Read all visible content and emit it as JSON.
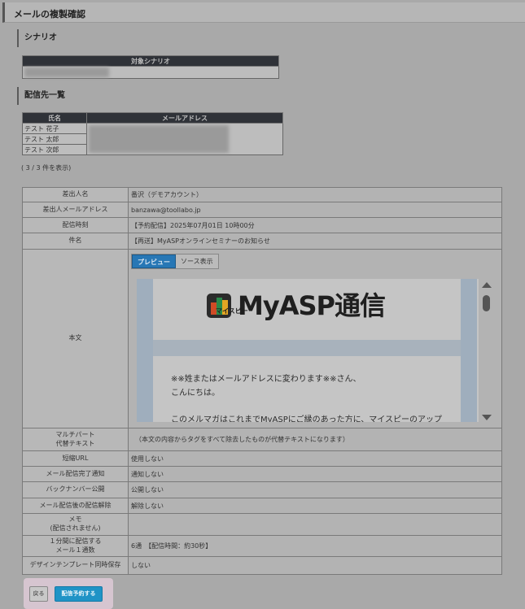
{
  "header": {
    "title": "メールの複製確認"
  },
  "scenario": {
    "section_title": "シナリオ",
    "column": "対象シナリオ"
  },
  "recipients": {
    "section_title": "配信先一覧",
    "columns": {
      "name": "氏名",
      "email": "メールアドレス"
    },
    "rows": [
      {
        "name": "テスト 花子"
      },
      {
        "name": "テスト 太郎"
      },
      {
        "name": "テスト 次郎"
      }
    ],
    "count_text": "( 3 / 3 件を表示)"
  },
  "details": {
    "sender_name": {
      "label": "差出人名",
      "value": "番沢（デモアカウント）"
    },
    "sender_email": {
      "label": "差出人メールアドレス",
      "value": "banzawa@toollabo.jp"
    },
    "send_time": {
      "label": "配信時刻",
      "value": "【予約配信】2025年07月01日 10時00分"
    },
    "subject": {
      "label": "件名",
      "value": "【再送】MyASPオンラインセミナーのお知らせ"
    },
    "body": {
      "label": "本文",
      "tab_preview": "プレビュー",
      "tab_source": "ソース表示",
      "logo_text": "MyASP通信",
      "logo_sub": "マイスピー",
      "line1": "※※姓またはメールアドレスに変わります※※さん、",
      "line2": "こんにちは。",
      "line3": "このメルマガはこれまでMyASPにご縁のあった方に、マイスピーのアップ"
    },
    "multipart": {
      "label_1": "マルチパート",
      "label_2": "代替テキスト",
      "value": "（本文の内容からタグをすべて除去したものが代替テキストになります）"
    },
    "short_url": {
      "label": "短縮URL",
      "value": "使用しない"
    },
    "completion_notice": {
      "label": "メール配信完了通知",
      "value": "通知しない"
    },
    "backnumber": {
      "label": "バックナンバー公開",
      "value": "公開しない"
    },
    "unsubscribe": {
      "label": "メール配信後の配信解除",
      "value": "解除しない"
    },
    "memo": {
      "label_1": "メモ",
      "label_2": "(配信されません)",
      "value": ""
    },
    "rate": {
      "label_1": "１分間に配信する",
      "label_2": "メール１通数",
      "value": "6通　【配信時間：約30秒】"
    },
    "template_save": {
      "label": "デザインテンプレート同時保存",
      "value": "しない"
    }
  },
  "actions": {
    "back_label": "戻る",
    "submit_label": "配信予約する"
  }
}
